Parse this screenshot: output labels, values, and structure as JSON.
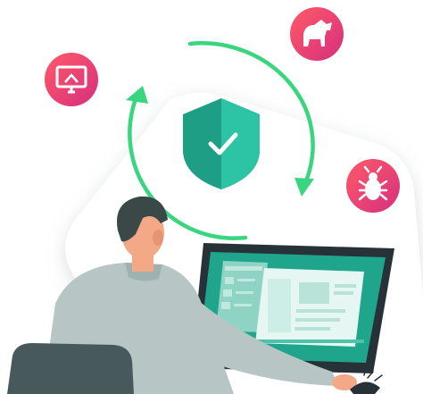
{
  "illustration": {
    "theme": "endpoint-security",
    "colors": {
      "shield_dark": "#1f9e86",
      "shield_light": "#2dc4a6",
      "cycle_arrow": "#39d67f",
      "threat_badge_start": "#ff4d6a",
      "threat_badge_end": "#d52f7e",
      "screen_bg": "#1fa58c",
      "monitor_frame": "#263238",
      "shirt": "#b7c6c5",
      "hair": "#3b4848",
      "skin": "#f3a886",
      "chair": "#47595a"
    },
    "icons": {
      "shield": "check-shield-icon",
      "threats": [
        "compromised-monitor-icon",
        "trojan-horse-icon",
        "bug-icon"
      ]
    }
  }
}
